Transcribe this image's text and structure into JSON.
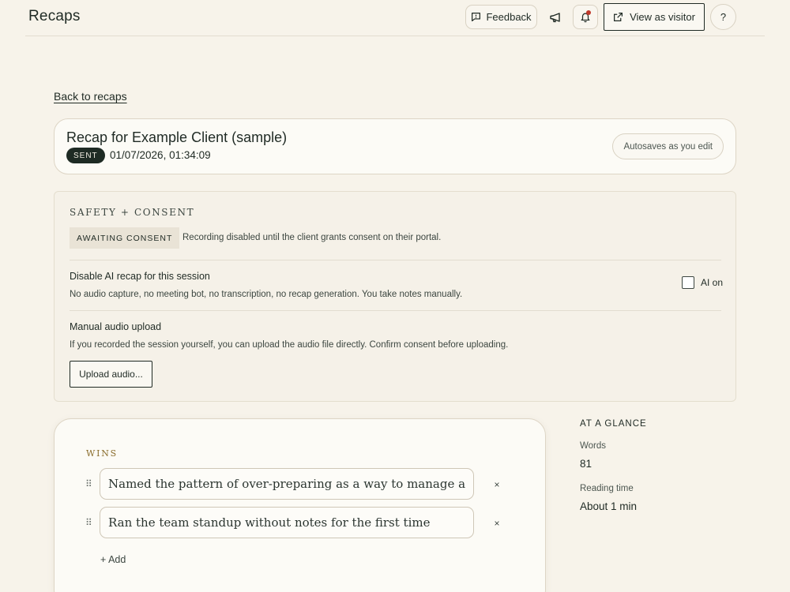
{
  "header": {
    "title": "Recaps",
    "feedback_label": "Feedback",
    "view_as_visitor_label": "View as visitor",
    "help_label": "?"
  },
  "nav": {
    "back_label": "Back to recaps"
  },
  "recap": {
    "title": "Recap for Example Client (sample)",
    "status": "SENT",
    "datetime": "01/07/2026, 01:34:09",
    "autosave_label": "Autosaves as you edit"
  },
  "safety": {
    "heading": "SAFETY + CONSENT",
    "consent_badge": "AWAITING CONSENT",
    "consent_text": "Recording disabled until the client grants consent on their portal.",
    "disable_ai": {
      "title": "Disable AI recap for this session",
      "description": "No audio capture, no meeting bot, no transcription, no recap generation. You take notes manually.",
      "toggle_label": "AI on",
      "checked": false
    },
    "manual_upload": {
      "title": "Manual audio upload",
      "description": "If you recorded the session yourself, you can upload the audio file directly. Confirm consent before uploading.",
      "button_label": "Upload audio..."
    }
  },
  "wins": {
    "heading": "WINS",
    "items": [
      {
        "value": "Named the pattern of over-preparing as a way to manage anxiety"
      },
      {
        "value": "Ran the team standup without notes for the first time"
      }
    ],
    "remove_label": "×",
    "add_label": "+ Add"
  },
  "glance": {
    "title": "AT A GLANCE",
    "words_label": "Words",
    "words_value": "81",
    "reading_label": "Reading time",
    "reading_value": "About 1 min"
  },
  "colors": {
    "background": "#f7f3ea",
    "ink": "#1f2a24",
    "accent_gold": "#8a6d2c",
    "notification_dot": "#c0392b"
  },
  "icons": [
    "feedback-icon",
    "megaphone-icon",
    "bell-icon",
    "external-link-icon",
    "drag-handle-icon",
    "close-icon"
  ]
}
